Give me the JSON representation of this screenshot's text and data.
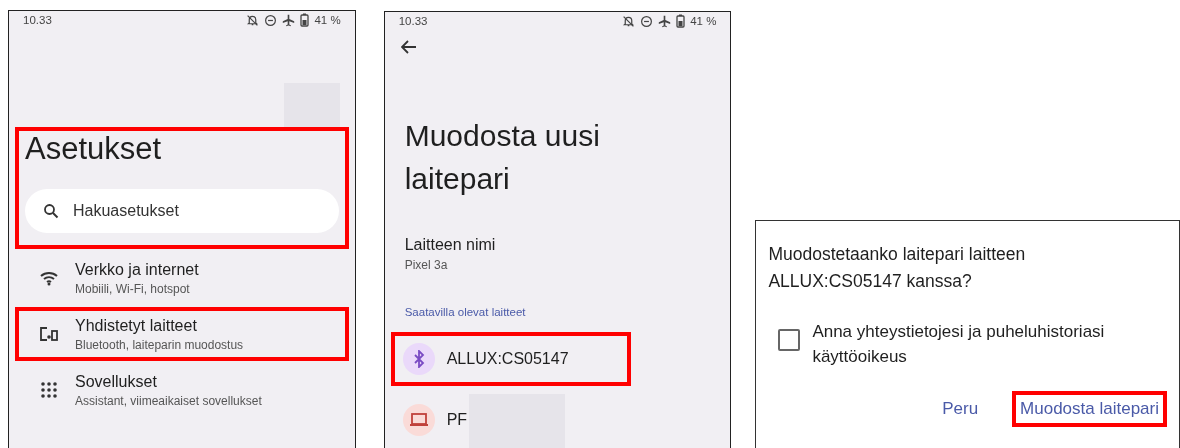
{
  "screens": [
    {
      "kind": "settings",
      "status": {
        "time": "10.33",
        "battery": "41 %"
      },
      "avatar_redacted": true,
      "header_highlighted": true,
      "title": "Asetukset",
      "search": {
        "placeholder": "Hakuasetukset"
      },
      "items": [
        {
          "title": "Verkko ja internet",
          "subtitle": "Mobiili, Wi-Fi, hotspot",
          "highlighted": false
        },
        {
          "title": "Yhdistetyt laitteet",
          "subtitle": "Bluetooth, laiteparin muodostus",
          "highlighted": true
        },
        {
          "title": "Sovellukset",
          "subtitle": "Assistant, viimeaikaiset sovellukset",
          "highlighted": false
        }
      ]
    },
    {
      "kind": "pairing",
      "status": {
        "time": "10.33",
        "battery": "41 %"
      },
      "title": "Muodosta uusi laitepari",
      "name_label": "Laitteen nimi",
      "name_value": "Pixel 3a",
      "section": "Saatavilla olevat laitteet",
      "devices": [
        {
          "name": "ALLUX:CS05147",
          "color": "#ead9fa",
          "highlighted": true,
          "redacted": false
        },
        {
          "name": "PF",
          "color": "#fadbd8",
          "highlighted": false,
          "redacted": true
        }
      ]
    },
    {
      "kind": "dialog",
      "title": "Muodostetaanko laitepari laitteen ALLUX:CS05147  kanssa?",
      "checkbox": {
        "label": "Anna yhteystietojesi ja puheluhistoriasi käyttöoikeus",
        "checked": false
      },
      "buttons": [
        {
          "label": "Peru",
          "highlighted": false
        },
        {
          "label": "Muodosta laitepari",
          "highlighted": true
        }
      ]
    }
  ]
}
